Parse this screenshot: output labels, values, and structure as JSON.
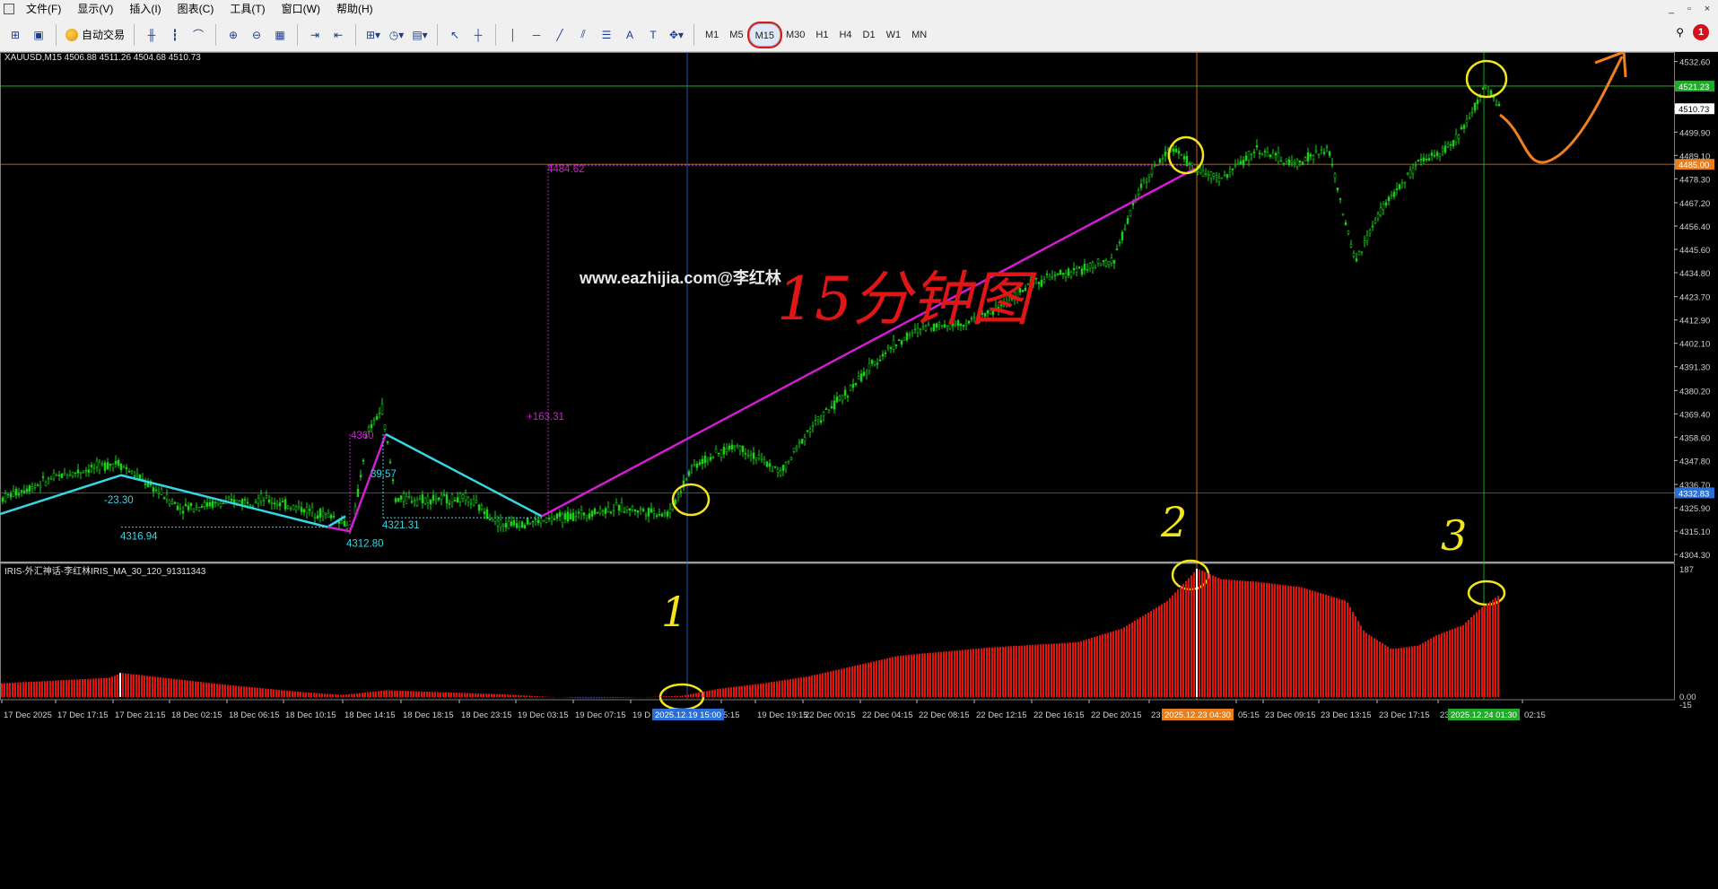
{
  "menu": {
    "items": [
      "文件(F)",
      "显示(V)",
      "插入(I)",
      "图表(C)",
      "工具(T)",
      "窗口(W)",
      "帮助(H)"
    ]
  },
  "window_controls": [
    "_",
    "▫",
    "×"
  ],
  "toolbar": {
    "auto_trade_label": "自动交易",
    "draw_text_label": "A",
    "timeframes": [
      "M1",
      "M5",
      "M15",
      "M30",
      "H1",
      "H4",
      "D1",
      "W1",
      "MN"
    ],
    "active_timeframe": "M15",
    "alert_count": "1"
  },
  "chart": {
    "symbol_title": "XAUUSD,M15  4506.88 4511.26 4504.68 4510.73",
    "watermark": "www.eazhijia.com@李红林",
    "handwriting_title": "15分钟图",
    "price_scale": [
      "4532.60",
      "4521.23",
      "4510.73",
      "4499.90",
      "4489.10",
      "4485.00",
      "4478.30",
      "4467.20",
      "4456.40",
      "4445.60",
      "4434.80",
      "4423.70",
      "4412.90",
      "4402.10",
      "4391.30",
      "4380.20",
      "4369.40",
      "4358.60",
      "4347.80",
      "4336.70",
      "4332.83",
      "4325.90",
      "4315.10",
      "4304.30"
    ],
    "price_tags": [
      {
        "value": "4521.23",
        "color": "#1faa2a"
      },
      {
        "value": "4510.73",
        "color": "#ffffff"
      },
      {
        "value": "4485.00",
        "color": "#e87e1c"
      },
      {
        "value": "4332.83",
        "color": "#2a6fd6"
      }
    ],
    "annotations": [
      {
        "text": "4484.62",
        "color": "#d21cd2"
      },
      {
        "text": "+163.31",
        "color": "#d21cd2"
      },
      {
        "text": "-23.30",
        "color": "#37d6e3"
      },
      {
        "text": "4316.94",
        "color": "#37d6e3"
      },
      {
        "text": "4312.80",
        "color": "#37d6e3"
      },
      {
        "text": "4321.31",
        "color": "#37d6e3"
      },
      {
        "text": "4360",
        "color": "#d21cd2"
      },
      {
        "text": "39.57",
        "color": "#37d6e3"
      }
    ],
    "handwritten_numbers": [
      "1",
      "2",
      "3"
    ],
    "time_axis": [
      "17 Dec 2025",
      "17 Dec 17:15",
      "17 Dec 21:15",
      "18 Dec 02:15",
      "18 Dec 06:15",
      "18 Dec 10:15",
      "18 Dec 14:15",
      "18 Dec 18:15",
      "18 Dec 23:15",
      "19 Dec 03:15",
      "19 Dec 07:15",
      "19 D",
      "5:15",
      "19 Dec 19:15",
      "22 Dec 00:15",
      "22 Dec 04:15",
      "22 Dec 08:15",
      "22 Dec 12:15",
      "22 Dec 16:15",
      "22 Dec 20:15",
      "23",
      "05:15",
      "23 Dec 09:15",
      "23 Dec 13:15",
      "23 Dec 17:15",
      "23",
      "02:15"
    ],
    "time_tags": [
      {
        "text": "2025.12.19 15:00",
        "color": "#2a6fd6"
      },
      {
        "text": "2025.12.23 04:30",
        "color": "#e87e1c"
      },
      {
        "text": "2025.12.24 01:30",
        "color": "#1faa2a"
      }
    ]
  },
  "indicator": {
    "title": "IRIS-外汇神话-李红林IRIS_MA_30_120_91311343",
    "scale": [
      "187",
      "0.00",
      "-15"
    ]
  },
  "colors": {
    "bull": "#19d219",
    "bear": "#19d219",
    "hist": "#e2140e",
    "hist_neg": "#1830ff",
    "trend": "#d21cd2",
    "cyan": "#37d6e3",
    "yellow": "#f2e51a",
    "orange": "#f0801e"
  }
}
